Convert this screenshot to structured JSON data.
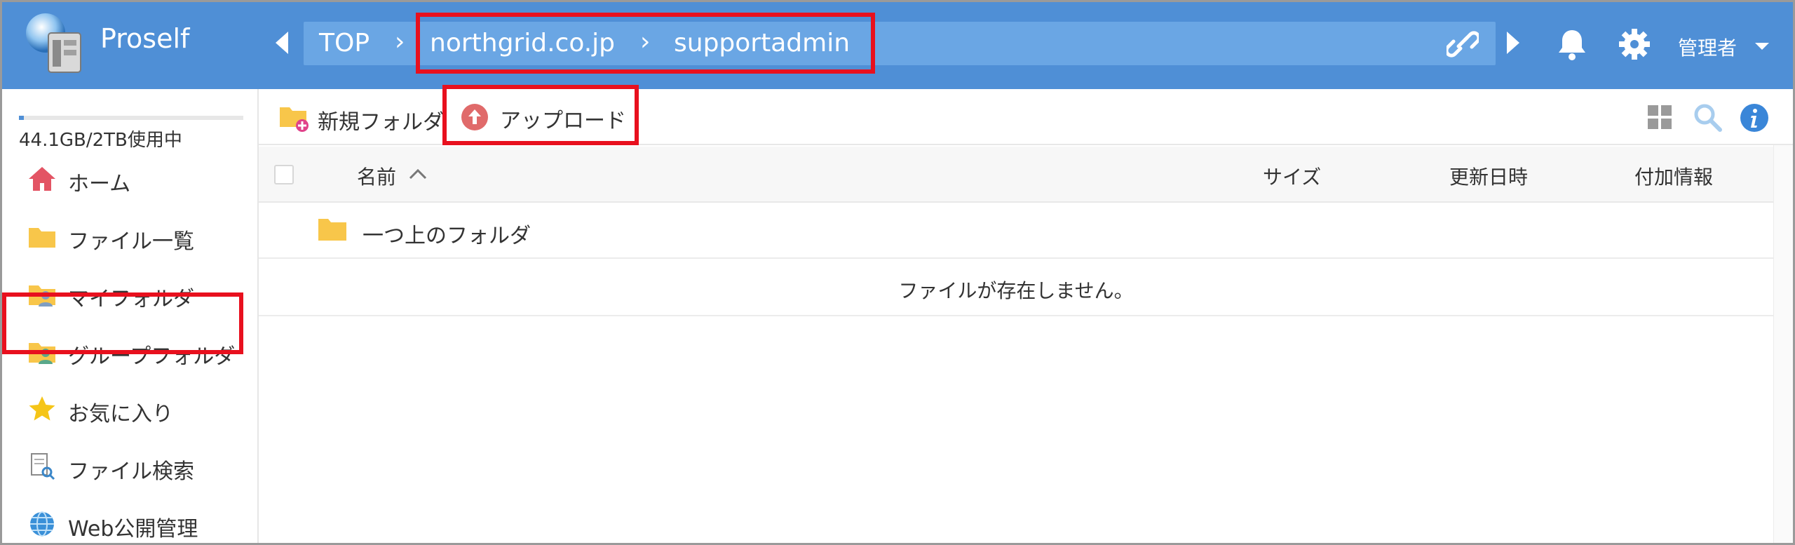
{
  "app": {
    "title": "Proself"
  },
  "breadcrumb": {
    "top": "TOP",
    "sep": "›",
    "items": [
      "northgrid.co.jp",
      "supportadmin"
    ]
  },
  "header": {
    "user": "管理者"
  },
  "sidebar": {
    "usage": "44.1GB/2TB使用中",
    "usage_fraction": 0.022,
    "items": [
      {
        "label": "ホーム",
        "icon": "home-icon"
      },
      {
        "label": "ファイル一覧",
        "icon": "folder-icon"
      },
      {
        "label": "マイフォルダ",
        "icon": "user-folder-icon"
      },
      {
        "label": "グループフォルダ",
        "icon": "group-folder-icon"
      },
      {
        "label": "お気に入り",
        "icon": "star-icon"
      },
      {
        "label": "ファイル検索",
        "icon": "file-search-icon"
      },
      {
        "label": "Web公開管理",
        "icon": "globe-icon"
      }
    ]
  },
  "toolbar": {
    "new_folder": "新規フォルダ",
    "upload": "アップロード"
  },
  "table": {
    "columns": {
      "name": "名前",
      "size": "サイズ",
      "modified": "更新日時",
      "extra": "付加情報"
    },
    "parent_folder": "一つ上のフォルダ",
    "empty_message": "ファイルが存在しません。"
  },
  "colors": {
    "header": "#4f8fd6",
    "breadcrumb_bar": "#6aa6e4",
    "highlight": "#e8101e",
    "folder": "#f8c64a"
  }
}
